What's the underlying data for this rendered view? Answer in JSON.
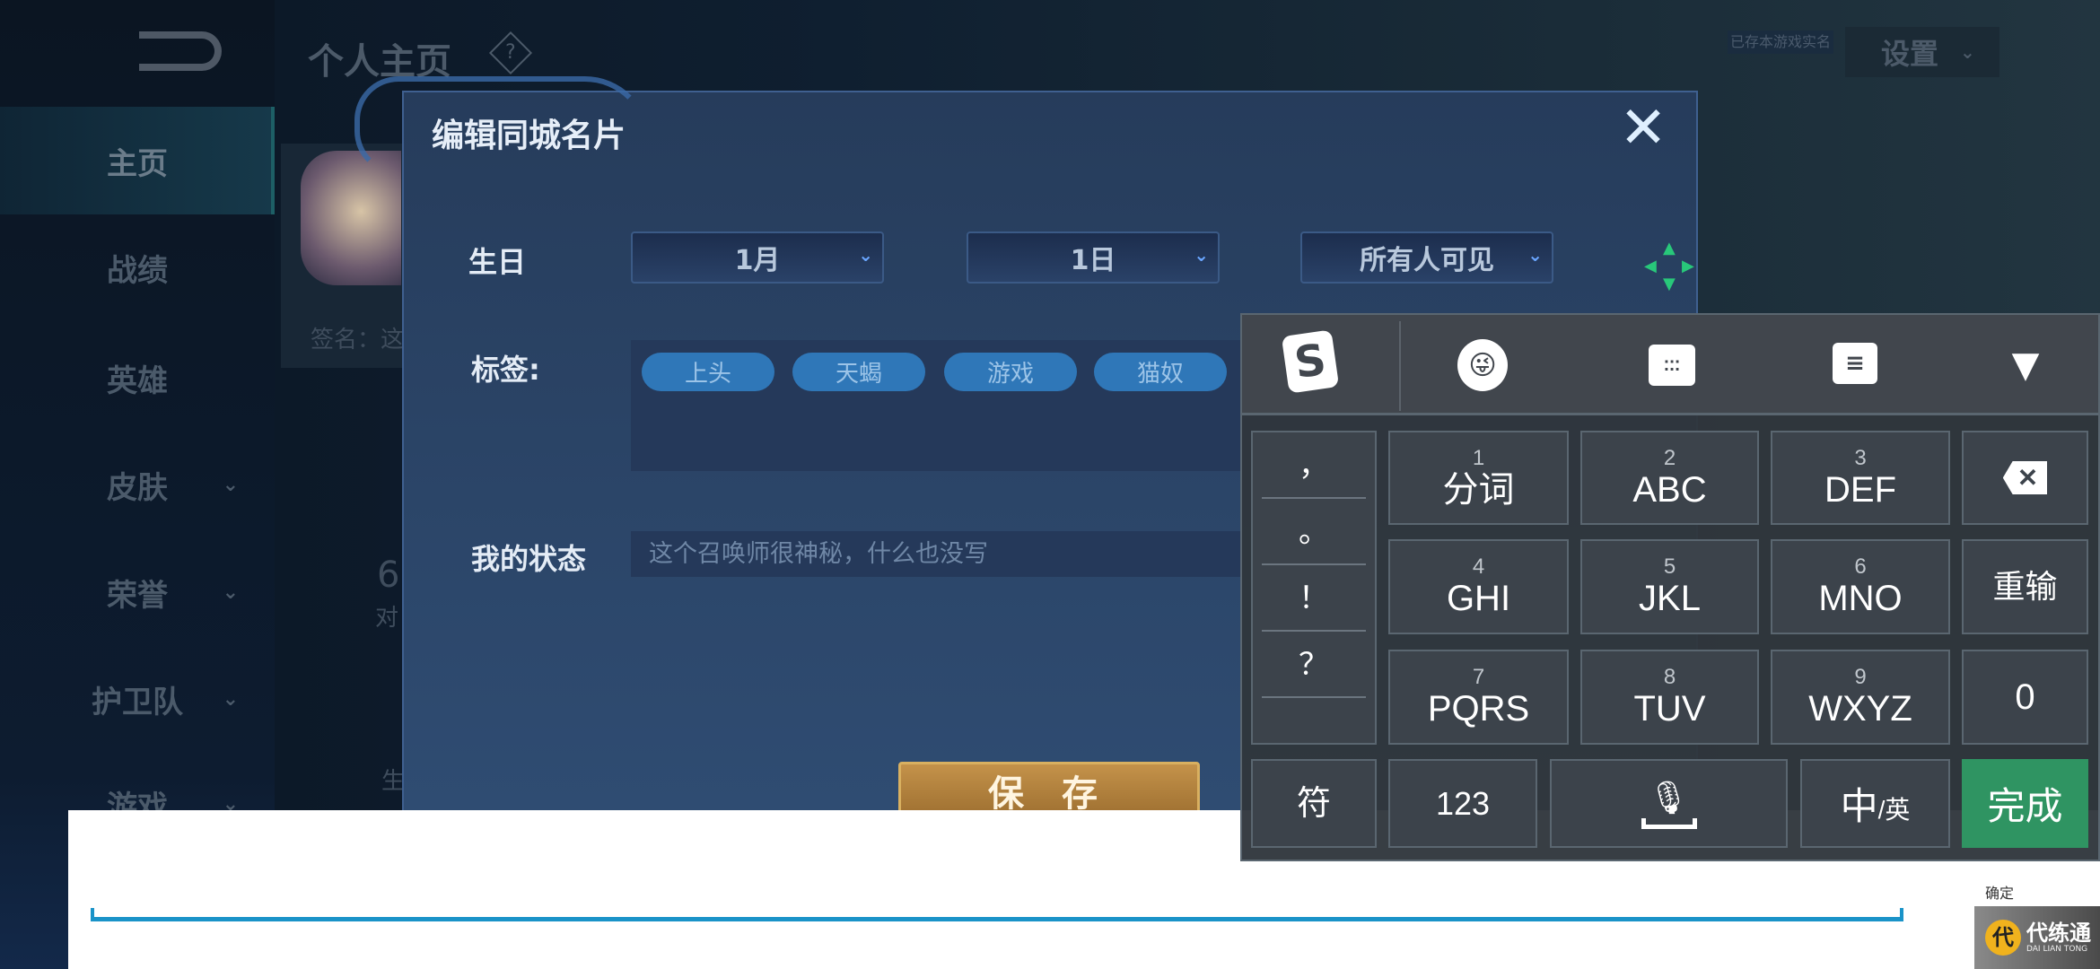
{
  "background": {
    "page_title": "个人主页",
    "help_icon": "question-diamond-icon",
    "realname_badge": "已存本游戏实名",
    "settings_label": "设置",
    "signature_partial": "签名：这",
    "stat_number_partial": "6",
    "stat_label_partial": "对",
    "bottom_partial": "生",
    "sidebar": {
      "items": [
        {
          "label": "主页",
          "selected": true
        },
        {
          "label": "战绩"
        },
        {
          "label": "英雄"
        },
        {
          "label": "皮肤",
          "expandable": true
        },
        {
          "label": "荣誉",
          "expandable": true
        },
        {
          "label": "护卫队",
          "expandable": true
        },
        {
          "label": "游戏",
          "expandable": true
        }
      ]
    }
  },
  "dialog": {
    "title": "编辑同城名片",
    "birthday_label": "生日",
    "month": "1月",
    "day": "1日",
    "visibility": "所有人可见",
    "tags_label": "标签:",
    "tags": [
      "上头",
      "天蝎",
      "游戏",
      "猫奴"
    ],
    "status_label": "我的状态",
    "status_placeholder": "这个召唤师很神秘，什么也没写",
    "save_label": "保 存"
  },
  "keyboard": {
    "toolbar_icons": [
      "sogou-logo-icon",
      "emoji-icon",
      "keyboard-switch-icon",
      "message-icon",
      "collapse-triangle-icon"
    ],
    "punctuation": [
      "，",
      "。",
      "！",
      "？"
    ],
    "keys": [
      {
        "num": "1",
        "label": "分词"
      },
      {
        "num": "2",
        "label": "ABC"
      },
      {
        "num": "3",
        "label": "DEF"
      },
      {
        "label": "backspace"
      },
      {
        "num": "4",
        "label": "GHI"
      },
      {
        "num": "5",
        "label": "JKL"
      },
      {
        "num": "6",
        "label": "MNO"
      },
      {
        "label": "重输"
      },
      {
        "num": "7",
        "label": "PQRS"
      },
      {
        "num": "8",
        "label": "TUV"
      },
      {
        "num": "9",
        "label": "WXYZ"
      },
      {
        "label": "0"
      }
    ],
    "symbol_key": "符",
    "num_key": "123",
    "lang_key_main": "中",
    "lang_key_sub": "/英",
    "done_key": "完成",
    "done_color": "#2f9462"
  },
  "footer": {
    "confirm_label": "确定",
    "logo_text": "代练通",
    "logo_sub": "DAI LIAN TONG",
    "line_color": "#1a93c8"
  }
}
